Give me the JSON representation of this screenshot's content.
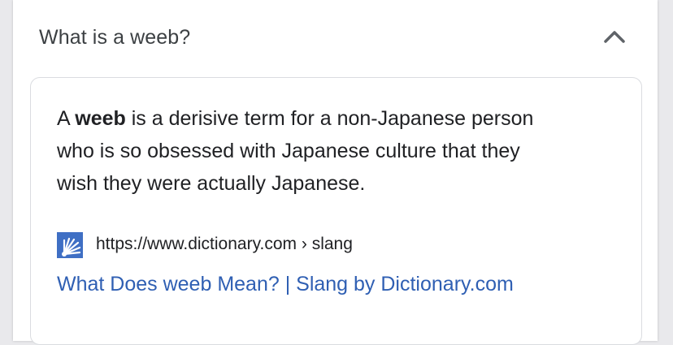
{
  "faq": {
    "question": "What is a weeb?",
    "expanded_icon": "chevron-up-icon",
    "answer": {
      "prefix": "A ",
      "term": "weeb",
      "line1_rest": " is a derisive term for a non-Japanese person",
      "line2": "who is so obsessed with Japanese culture that they",
      "line3": "wish they were actually Japanese."
    },
    "source": {
      "favicon": "dictionary-favicon-icon",
      "url": "https://www.dictionary.com",
      "separator": " › ",
      "path": "slang",
      "link_title": "What Does weeb Mean? | Slang by Dictionary.com"
    }
  },
  "colors": {
    "link": "#2f5fb3",
    "text": "#202124",
    "border": "#dadce0",
    "favicon": "#3f6fc4"
  }
}
